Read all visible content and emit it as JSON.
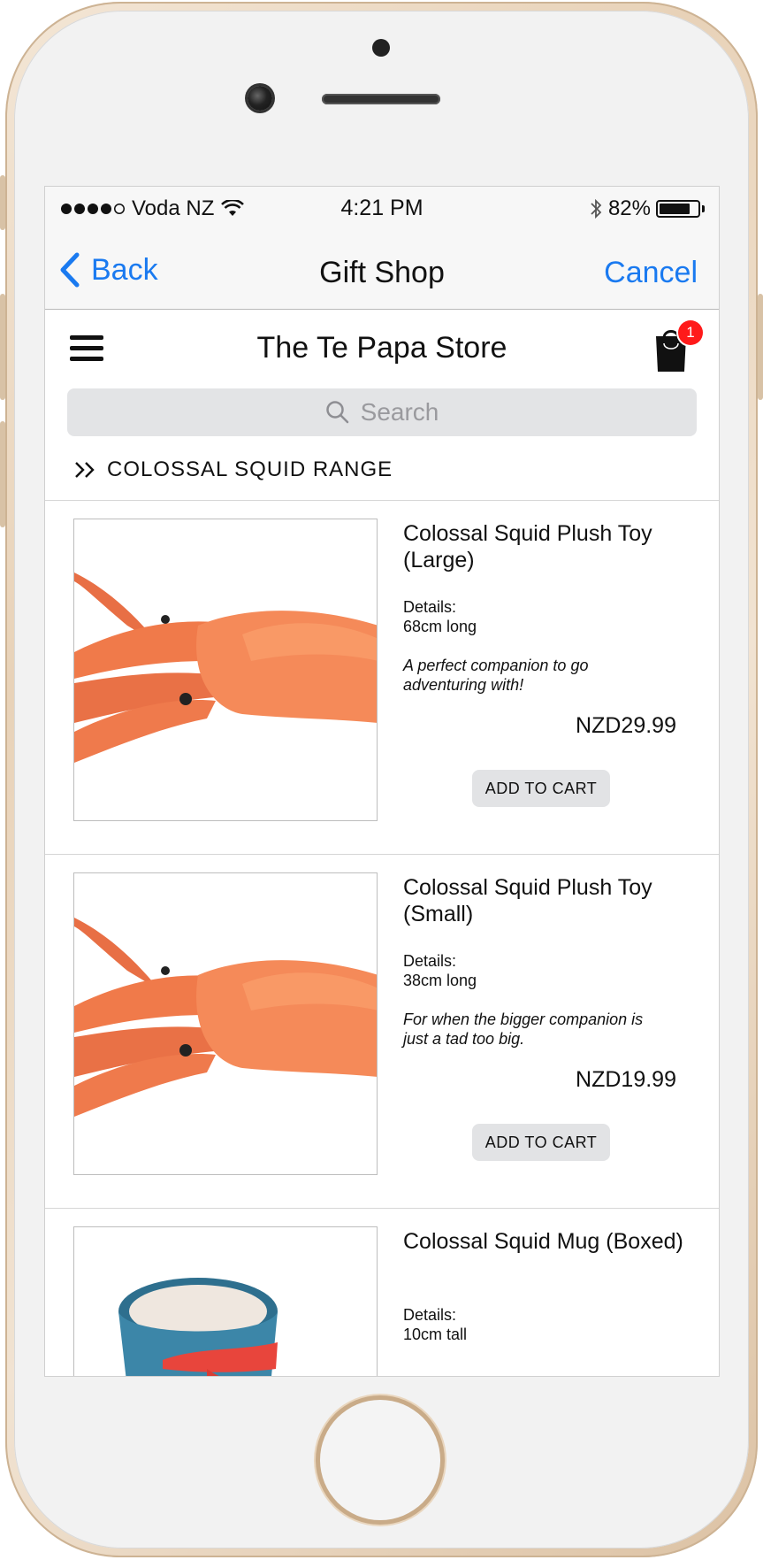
{
  "status_bar": {
    "carrier": "Voda NZ",
    "time": "4:21 PM",
    "battery": "82%",
    "battery_level": 0.82
  },
  "nav": {
    "back_label": "Back",
    "title": "Gift Shop",
    "cancel_label": "Cancel"
  },
  "store": {
    "title": "The Te Papa Store",
    "cart_count": "1"
  },
  "search": {
    "placeholder": "Search"
  },
  "category": {
    "label": "COLOSSAL SQUID RANGE"
  },
  "products": [
    {
      "name": "Colossal Squid Plush Toy (Large)",
      "details_label": "Details:",
      "details_value": "68cm long",
      "description": "A perfect companion to go adventuring with!",
      "price": "NZD29.99",
      "button_label": "ADD TO CART"
    },
    {
      "name": "Colossal Squid Plush Toy (Small)",
      "details_label": "Details:",
      "details_value": "38cm long",
      "description": "For when the bigger companion is just a tad too big.",
      "price": "NZD19.99",
      "button_label": "ADD TO CART"
    },
    {
      "name": "Colossal Squid Mug (Boxed)",
      "details_label": "Details:",
      "details_value": "10cm tall"
    }
  ],
  "colors": {
    "accent": "#1a7af0",
    "badge": "#ff1a1a",
    "button_bg": "#e2e3e5",
    "squid": "#f07a4a"
  }
}
